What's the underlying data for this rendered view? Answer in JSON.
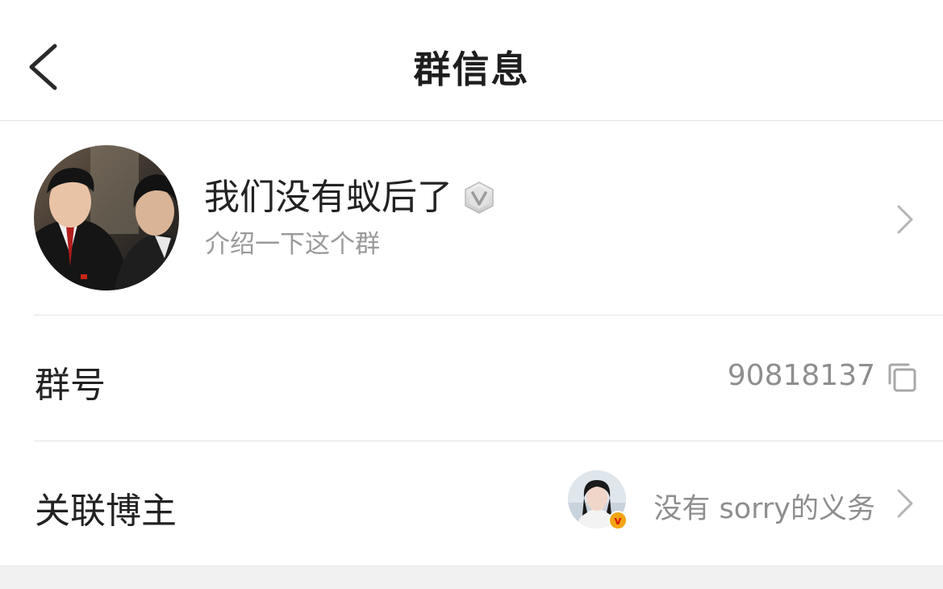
{
  "header": {
    "title": "群信息",
    "back_icon": "chevron-left-icon"
  },
  "group": {
    "name": "我们没有蚁后了",
    "description": "介绍一下这个群",
    "badge_icon": "verified-v-icon",
    "chevron_icon": "chevron-right-icon"
  },
  "group_number": {
    "label": "群号",
    "value": "90818137",
    "copy_icon": "copy-icon"
  },
  "linked_blogger": {
    "label": "关联博主",
    "name": "没有 sorry的义务",
    "badge_text": "v",
    "chevron_icon": "chevron-right-icon"
  },
  "colors": {
    "text_primary": "#222222",
    "text_secondary": "#9a9a9a",
    "divider": "#e3e3e3",
    "footer_bg": "#f1f1f1",
    "vip_badge": "#f2a413"
  }
}
